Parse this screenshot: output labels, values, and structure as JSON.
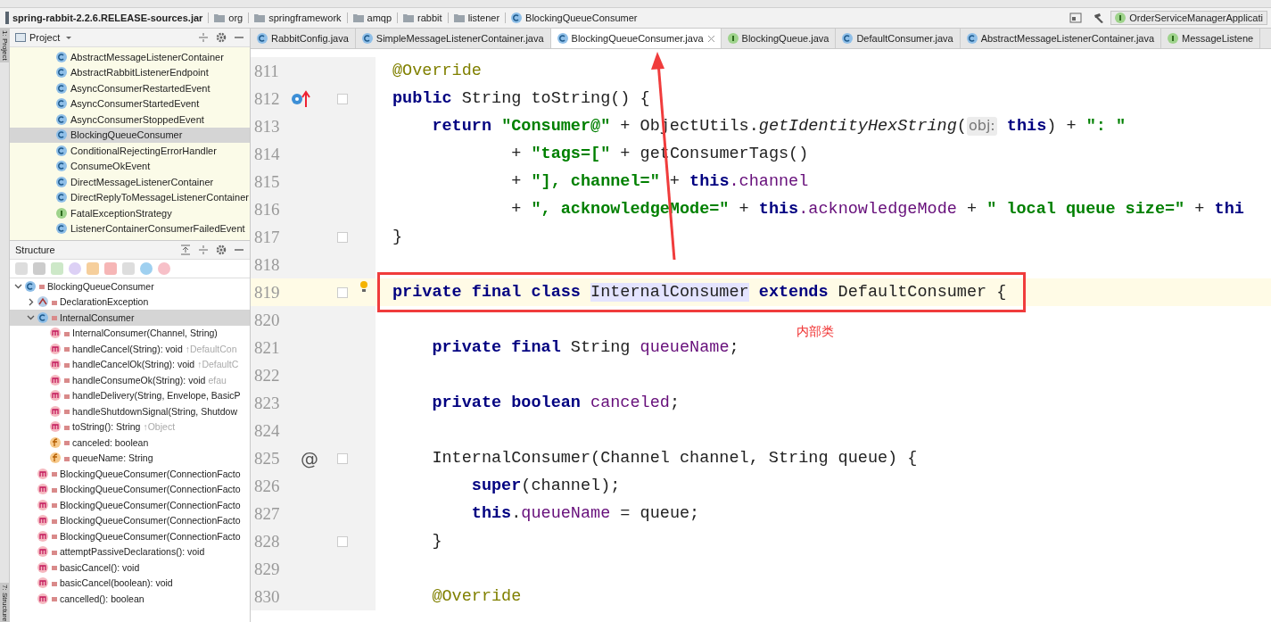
{
  "breadcrumb": {
    "items": [
      {
        "label": "spring-rabbit-2.2.6.RELEASE-sources.jar",
        "kind": "jar"
      },
      {
        "label": "org",
        "kind": "folder"
      },
      {
        "label": "springframework",
        "kind": "folder"
      },
      {
        "label": "amqp",
        "kind": "folder"
      },
      {
        "label": "rabbit",
        "kind": "folder"
      },
      {
        "label": "listener",
        "kind": "folder"
      },
      {
        "label": "BlockingQueueConsumer",
        "kind": "class"
      }
    ],
    "run_config": "OrderServiceManagerApplicati"
  },
  "side_stripe": {
    "top": "1: Project",
    "bottom": "7: Structure"
  },
  "project_panel": {
    "title": "Project",
    "items": [
      {
        "label": "AbstractMessageListenerContainer",
        "kind": "class",
        "selected": false
      },
      {
        "label": "AbstractRabbitListenerEndpoint",
        "kind": "class",
        "selected": false
      },
      {
        "label": "AsyncConsumerRestartedEvent",
        "kind": "class",
        "selected": false
      },
      {
        "label": "AsyncConsumerStartedEvent",
        "kind": "class",
        "selected": false
      },
      {
        "label": "AsyncConsumerStoppedEvent",
        "kind": "class",
        "selected": false
      },
      {
        "label": "BlockingQueueConsumer",
        "kind": "class",
        "selected": true
      },
      {
        "label": "ConditionalRejectingErrorHandler",
        "kind": "class",
        "selected": false
      },
      {
        "label": "ConsumeOkEvent",
        "kind": "class",
        "selected": false
      },
      {
        "label": "DirectMessageListenerContainer",
        "kind": "class",
        "selected": false
      },
      {
        "label": "DirectReplyToMessageListenerContainer",
        "kind": "class",
        "selected": false
      },
      {
        "label": "FatalExceptionStrategy",
        "kind": "interface",
        "selected": false
      },
      {
        "label": "ListenerContainerConsumerFailedEvent",
        "kind": "class",
        "selected": false
      }
    ]
  },
  "structure_panel": {
    "title": "Structure",
    "tree": [
      {
        "label": "BlockingQueueConsumer",
        "kind": "class",
        "expanded": true,
        "selected": false,
        "children": [
          {
            "label": "DeclarationException",
            "kind": "exception",
            "expanded": false,
            "selected": false
          },
          {
            "label": "InternalConsumer",
            "kind": "class",
            "expanded": true,
            "selected": true,
            "children": [
              {
                "label": "InternalConsumer(Channel, String)",
                "kind": "method",
                "selected": false
              },
              {
                "label": "handleCancel(String): void",
                "hint": "↑DefaultCon",
                "kind": "method",
                "selected": false
              },
              {
                "label": "handleCancelOk(String): void",
                "hint": "↑DefaultC",
                "kind": "method",
                "selected": false
              },
              {
                "label": "handleConsumeOk(String): void",
                "hint": "efau",
                "kind": "method",
                "selected": false
              },
              {
                "label": "handleDelivery(String, Envelope, BasicP",
                "kind": "method",
                "selected": false
              },
              {
                "label": "handleShutdownSignal(String, Shutdow",
                "kind": "method",
                "selected": false
              },
              {
                "label": "toString(): String",
                "hint": "↑Object",
                "kind": "method",
                "selected": false
              },
              {
                "label": "canceled: boolean",
                "kind": "field",
                "selected": false
              },
              {
                "label": "queueName: String",
                "kind": "field",
                "selected": false
              }
            ]
          },
          {
            "label": "BlockingQueueConsumer(ConnectionFacto",
            "kind": "method",
            "selected": false
          },
          {
            "label": "BlockingQueueConsumer(ConnectionFacto",
            "kind": "method",
            "selected": false
          },
          {
            "label": "BlockingQueueConsumer(ConnectionFacto",
            "kind": "method",
            "selected": false
          },
          {
            "label": "BlockingQueueConsumer(ConnectionFacto",
            "kind": "method",
            "selected": false
          },
          {
            "label": "BlockingQueueConsumer(ConnectionFacto",
            "kind": "method",
            "selected": false
          },
          {
            "label": "attemptPassiveDeclarations(): void",
            "kind": "method",
            "selected": false
          },
          {
            "label": "basicCancel(): void",
            "kind": "method",
            "selected": false
          },
          {
            "label": "basicCancel(boolean): void",
            "kind": "method",
            "selected": false
          },
          {
            "label": "cancelled(): boolean",
            "kind": "method",
            "selected": false
          }
        ]
      }
    ]
  },
  "tabs": [
    {
      "label": "RabbitConfig.java",
      "kind": "class",
      "selected": false
    },
    {
      "label": "SimpleMessageListenerContainer.java",
      "kind": "class",
      "selected": false
    },
    {
      "label": "BlockingQueueConsumer.java",
      "kind": "class",
      "selected": true
    },
    {
      "label": "BlockingQueue.java",
      "kind": "interface",
      "selected": false
    },
    {
      "label": "DefaultConsumer.java",
      "kind": "class",
      "selected": false
    },
    {
      "label": "AbstractMessageListenerContainer.java",
      "kind": "class",
      "selected": false
    },
    {
      "label": "MessageListene",
      "kind": "interface",
      "selected": false
    }
  ],
  "editor": {
    "note": "内部类",
    "lines": [
      {
        "number": "811",
        "tokens": [
          {
            "text": "@Override",
            "kind": "annotation"
          }
        ]
      },
      {
        "number": "812",
        "kind": "override",
        "fold": true,
        "tokens": [
          {
            "text": "public",
            "kind": "keyword"
          },
          {
            "text": " String toString() {",
            "kind": "plain"
          }
        ]
      },
      {
        "number": "813",
        "tokens": [
          {
            "text": "    return ",
            "kind": "keyword"
          },
          {
            "text": "\"Consumer@\"",
            "kind": "string"
          },
          {
            "text": " + ObjectUtils.",
            "kind": "plain"
          },
          {
            "text": "getIdentityHexString",
            "kind": "static"
          },
          {
            "text": "(",
            "kind": "plain"
          },
          {
            "text": "obj:",
            "kind": "hint"
          },
          {
            "text": " this",
            "kind": "keyword"
          },
          {
            "text": ") + ",
            "kind": "plain"
          },
          {
            "text": "\": \"",
            "kind": "string"
          }
        ]
      },
      {
        "number": "814",
        "tokens": [
          {
            "text": "            + ",
            "kind": "plain"
          },
          {
            "text": "\"tags=[\"",
            "kind": "string"
          },
          {
            "text": " + getConsumerTags()",
            "kind": "plain"
          }
        ]
      },
      {
        "number": "815",
        "tokens": [
          {
            "text": "            + ",
            "kind": "plain"
          },
          {
            "text": "\"], channel=\"",
            "kind": "string"
          },
          {
            "text": " + ",
            "kind": "plain"
          },
          {
            "text": "this",
            "kind": "keyword"
          },
          {
            "text": ".channel",
            "kind": "field"
          }
        ]
      },
      {
        "number": "816",
        "tokens": [
          {
            "text": "            + ",
            "kind": "plain"
          },
          {
            "text": "\", acknowledgeMode=\"",
            "kind": "string"
          },
          {
            "text": " + ",
            "kind": "plain"
          },
          {
            "text": "this",
            "kind": "keyword"
          },
          {
            "text": ".acknowledgeMode",
            "kind": "field"
          },
          {
            "text": " + ",
            "kind": "plain"
          },
          {
            "text": "\" local queue size=\"",
            "kind": "string"
          },
          {
            "text": " + ",
            "kind": "plain"
          },
          {
            "text": "thi",
            "kind": "keyword"
          }
        ]
      },
      {
        "number": "817",
        "fold": true,
        "tokens": [
          {
            "text": "}",
            "kind": "plain"
          }
        ]
      },
      {
        "number": "818"
      },
      {
        "number": "819",
        "kind": "bulb",
        "fold": true,
        "current": true,
        "boxed": true,
        "tokens": [
          {
            "text": "private final class ",
            "kind": "keyword"
          },
          {
            "text": "InternalConsumer",
            "kind": "usage"
          },
          {
            "text": " extends",
            "kind": "keyword"
          },
          {
            "text": " DefaultConsumer {",
            "kind": "plain"
          }
        ]
      },
      {
        "number": "820"
      },
      {
        "number": "821",
        "tokens": [
          {
            "text": "    private final",
            "kind": "keyword"
          },
          {
            "text": " String ",
            "kind": "plain"
          },
          {
            "text": "queueName",
            "kind": "field"
          },
          {
            "text": ";",
            "kind": "plain"
          }
        ]
      },
      {
        "number": "822"
      },
      {
        "number": "823",
        "tokens": [
          {
            "text": "    private boolean ",
            "kind": "keyword"
          },
          {
            "text": "canceled",
            "kind": "field"
          },
          {
            "text": ";",
            "kind": "plain"
          }
        ]
      },
      {
        "number": "824"
      },
      {
        "number": "825",
        "gutter_symbol": "@",
        "fold": true,
        "tokens": [
          {
            "text": "    InternalConsumer(Channel channel, String queue) {",
            "kind": "plain"
          }
        ]
      },
      {
        "number": "826",
        "tokens": [
          {
            "text": "        super",
            "kind": "keyword"
          },
          {
            "text": "(channel);",
            "kind": "plain"
          }
        ]
      },
      {
        "number": "827",
        "tokens": [
          {
            "text": "        this",
            "kind": "keyword"
          },
          {
            "text": ".",
            "kind": "plain"
          },
          {
            "text": "queueName",
            "kind": "field"
          },
          {
            "text": " = queue;",
            "kind": "plain"
          }
        ]
      },
      {
        "number": "828",
        "fold": true,
        "tokens": [
          {
            "text": "    }",
            "kind": "plain"
          }
        ]
      },
      {
        "number": "829"
      },
      {
        "number": "830",
        "tokens": [
          {
            "text": "    @Override",
            "kind": "annotation"
          }
        ]
      }
    ]
  }
}
